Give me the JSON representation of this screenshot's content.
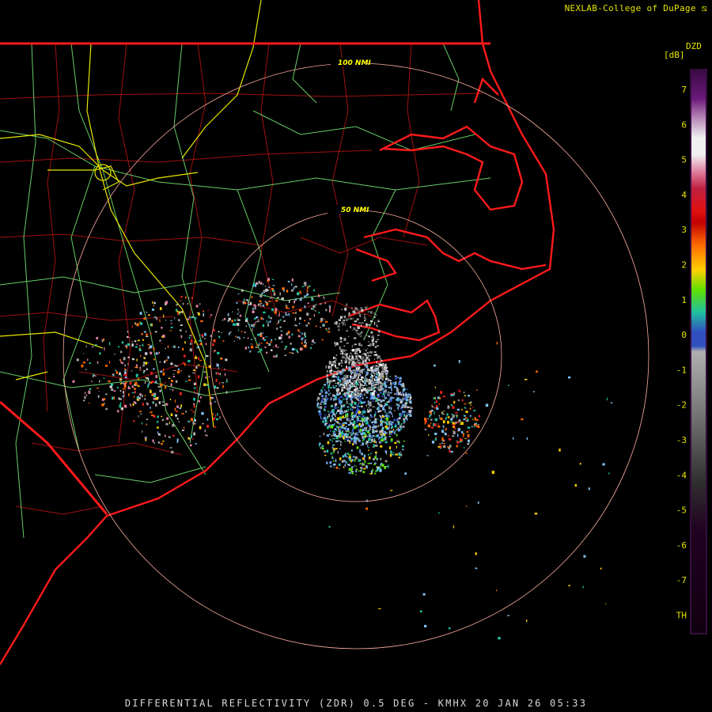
{
  "header": {
    "credit": "NEXLAB-College of DuPage"
  },
  "radar": {
    "site": "KMHX",
    "product": "DIFFERENTIAL REFLECTIVITY (ZDR)",
    "elevation": "0.5 DEG",
    "timestamp": "20 JAN 26 05:33",
    "caption": "DIFFERENTIAL REFLECTIVITY (ZDR) 0.5 DEG - KMHX 20 JAN 26 05:33",
    "range_rings": [
      {
        "label": "50 NMI"
      },
      {
        "label": "100 NMI"
      }
    ]
  },
  "legend": {
    "product_code": "DZD",
    "unit": "[dB]",
    "ticks": [
      "7",
      "6",
      "5",
      "4",
      "3",
      "2",
      "1",
      "0",
      "-1",
      "-2",
      "-3",
      "-4",
      "-5",
      "-6",
      "-7",
      "TH"
    ],
    "scale_colors": [
      "#3a0a45",
      "#6a1a7a",
      "#b07ab0",
      "#e8e8e8",
      "#e080a0",
      "#c02040",
      "#e02020",
      "#ff6a00",
      "#ffd000",
      "#60e000",
      "#20c0a0",
      "#3050c0",
      "#a0a0a0",
      "#505050",
      "#200020"
    ]
  },
  "colors": {
    "background": "#000000",
    "state_boundary": "#ff1a1a",
    "county_boundary": "#a01010",
    "highway": "#80ff80",
    "interstate": "#e6e600",
    "range_ring": "#ffb0a0"
  }
}
